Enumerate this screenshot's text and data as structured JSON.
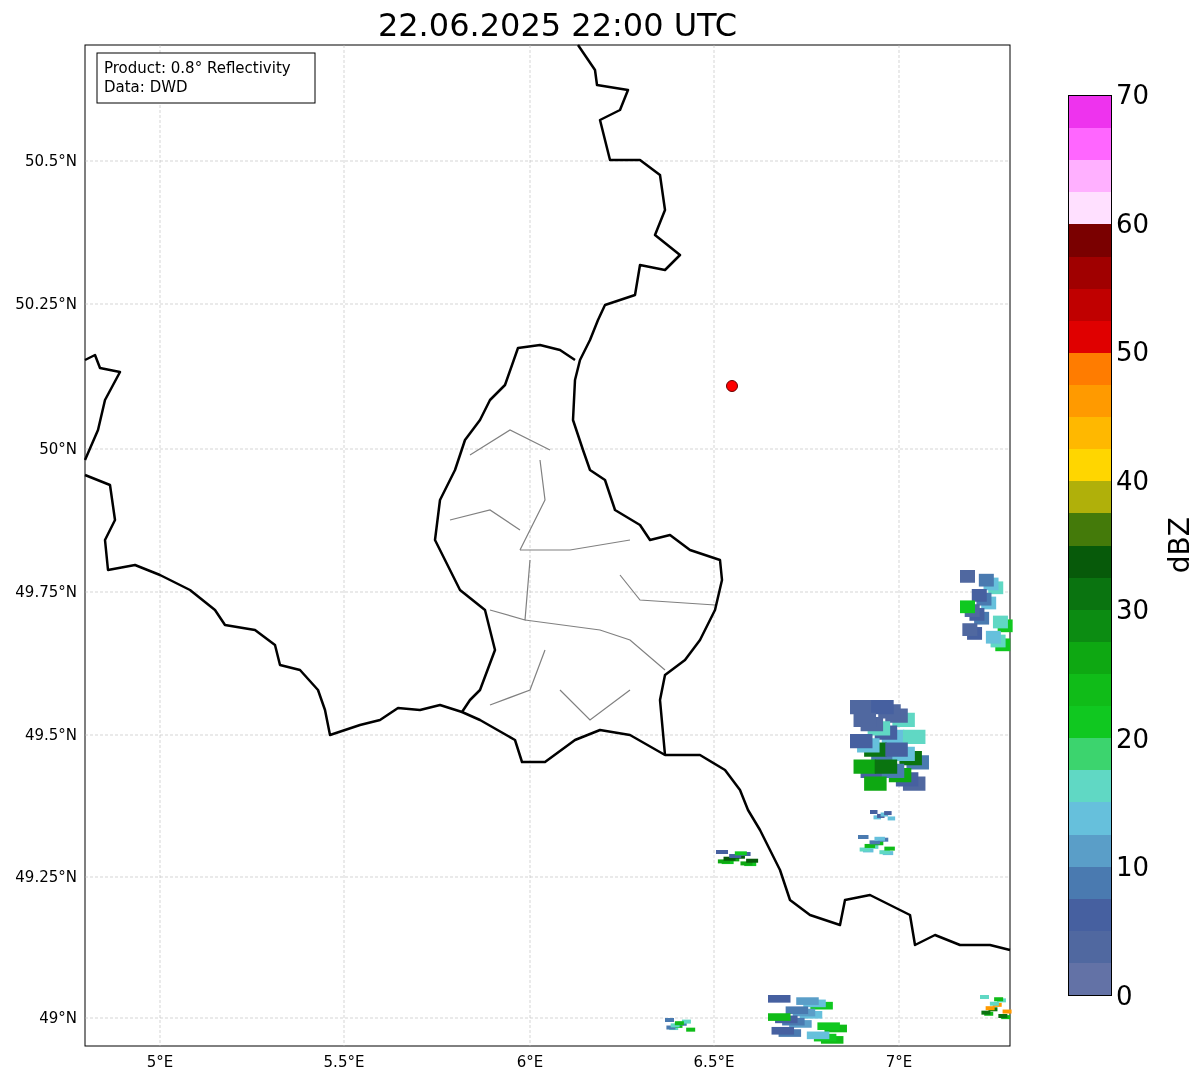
{
  "title": "22.06.2025 22:00 UTC",
  "info_box": {
    "lines": [
      "Product: 0.8° Reflectivity",
      "Data: DWD"
    ]
  },
  "map": {
    "x_ticks": [
      "5°E",
      "5.5°E",
      "6°E",
      "6.5°E",
      "7°E"
    ],
    "y_ticks": [
      "50.5°N",
      "50.25°N",
      "50°N",
      "49.75°N",
      "49.5°N",
      "49.25°N",
      "49°N"
    ]
  },
  "colorbar": {
    "label": "dBZ",
    "ticks": [
      "70",
      "60",
      "50",
      "40",
      "30",
      "20",
      "10",
      "0"
    ],
    "segments": [
      {
        "color": "#ee33ee"
      },
      {
        "color": "#ff66ff"
      },
      {
        "color": "#ffb0ff"
      },
      {
        "color": "#ffe0ff"
      },
      {
        "color": "#7a0000"
      },
      {
        "color": "#a00000"
      },
      {
        "color": "#c00000"
      },
      {
        "color": "#e00000"
      },
      {
        "color": "#ff7c00"
      },
      {
        "color": "#ff9a00"
      },
      {
        "color": "#ffb800"
      },
      {
        "color": "#ffd600"
      },
      {
        "color": "#b0b00a"
      },
      {
        "color": "#447a0a"
      },
      {
        "color": "#075a0a"
      },
      {
        "color": "#0a7410"
      },
      {
        "color": "#0c8c12"
      },
      {
        "color": "#0ea812"
      },
      {
        "color": "#10bc18"
      },
      {
        "color": "#10c820"
      },
      {
        "color": "#3cd46e"
      },
      {
        "color": "#60d8c4"
      },
      {
        "color": "#66c0dc"
      },
      {
        "color": "#5a9ec8"
      },
      {
        "color": "#4a7ab0"
      },
      {
        "color": "#4660a0"
      },
      {
        "color": "#5068a0"
      },
      {
        "color": "#6372a6"
      }
    ]
  }
}
